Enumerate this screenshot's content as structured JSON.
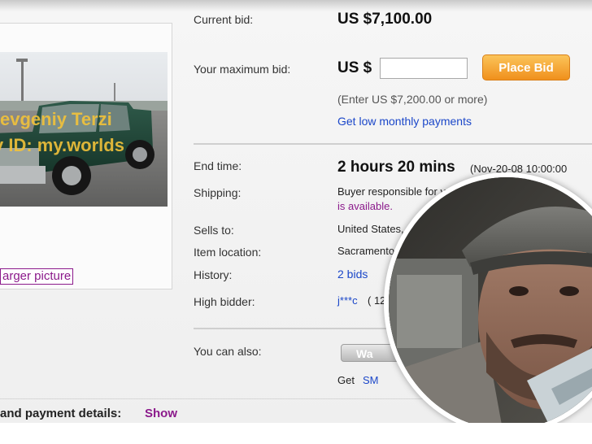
{
  "bid": {
    "current_bid_label": "Current bid:",
    "current_bid_value": "US $7,100.00",
    "max_bid_label": "Your maximum bid:",
    "currency_prefix": "US $",
    "max_bid_input_value": "",
    "place_bid_label": "Place Bid",
    "min_bid_hint": "(Enter US $7,200.00 or more)",
    "monthly_payments_link": "Get low monthly payments"
  },
  "details": {
    "end_time_label": "End time:",
    "end_time_value": "2 hours 20 mins",
    "end_time_date": "(Nov-20-08 10:00:00",
    "shipping_label": "Shipping:",
    "shipping_value": "Buyer responsible for v",
    "shipping_note": "is available.",
    "sells_to_label": "Sells to:",
    "sells_to_value": "United States, C",
    "location_label": "Item location:",
    "location_value": "Sacramento,",
    "history_label": "History:",
    "history_value": "2 bids",
    "high_bidder_label": "High bidder:",
    "high_bidder_value": "j***c",
    "high_bidder_score": "( 12"
  },
  "actions": {
    "also_label": "You can also:",
    "watch_button_label": "Wa",
    "get_prefix": "Get",
    "sms_link": "SM"
  },
  "photo": {
    "watermark_line1": "evgeniy Terzi",
    "watermark_line2": "y ID: my.worlds",
    "larger_picture_link": "arger picture"
  },
  "footer": {
    "payment_label": "and payment details:",
    "show_link": "Show"
  }
}
